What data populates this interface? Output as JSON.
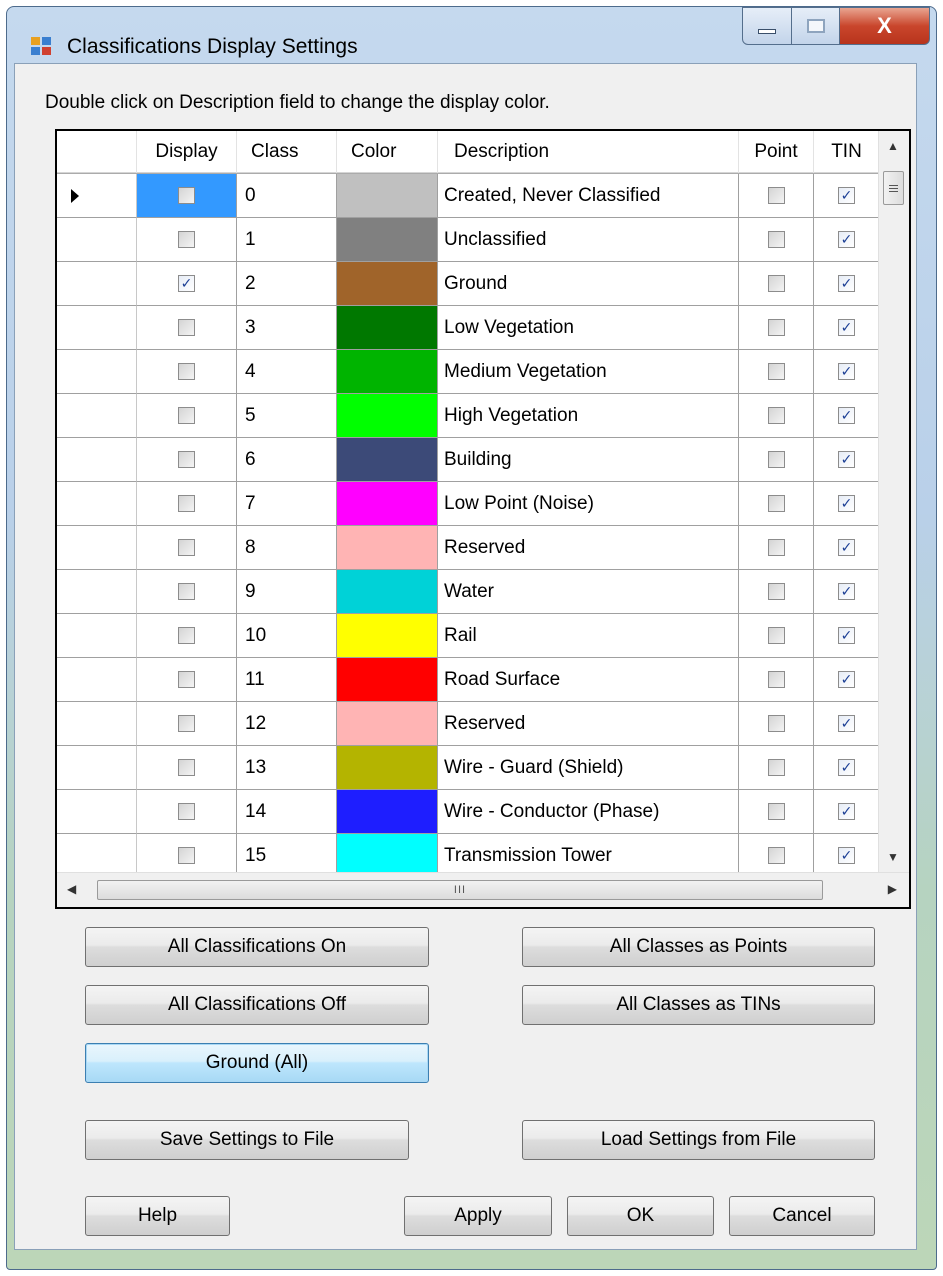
{
  "window": {
    "title": "Classifications Display Settings",
    "close_glyph": "X"
  },
  "instruction": "Double click on Description field to change the display color.",
  "grid": {
    "columns": [
      "Display",
      "Class",
      "Color",
      "Description",
      "Point",
      "TIN"
    ],
    "rows": [
      {
        "display": false,
        "class": "0",
        "color": "#c0c0c0",
        "description": "Created, Never Classified",
        "point": false,
        "tin": true
      },
      {
        "display": false,
        "class": "1",
        "color": "#808080",
        "description": "Unclassified",
        "point": false,
        "tin": true
      },
      {
        "display": true,
        "class": "2",
        "color": "#a0642a",
        "description": "Ground",
        "point": false,
        "tin": true
      },
      {
        "display": false,
        "class": "3",
        "color": "#007800",
        "description": "Low Vegetation",
        "point": false,
        "tin": true
      },
      {
        "display": false,
        "class": "4",
        "color": "#00b400",
        "description": "Medium Vegetation",
        "point": false,
        "tin": true
      },
      {
        "display": false,
        "class": "5",
        "color": "#00ff00",
        "description": "High Vegetation",
        "point": false,
        "tin": true
      },
      {
        "display": false,
        "class": "6",
        "color": "#3c4a78",
        "description": "Building",
        "point": false,
        "tin": true
      },
      {
        "display": false,
        "class": "7",
        "color": "#ff00ff",
        "description": "Low Point (Noise)",
        "point": false,
        "tin": true
      },
      {
        "display": false,
        "class": "8",
        "color": "#ffb4b4",
        "description": "Reserved",
        "point": false,
        "tin": true
      },
      {
        "display": false,
        "class": "9",
        "color": "#00d2d7",
        "description": "Water",
        "point": false,
        "tin": true
      },
      {
        "display": false,
        "class": "10",
        "color": "#ffff00",
        "description": "Rail",
        "point": false,
        "tin": true
      },
      {
        "display": false,
        "class": "11",
        "color": "#ff0000",
        "description": "Road Surface",
        "point": false,
        "tin": true
      },
      {
        "display": false,
        "class": "12",
        "color": "#ffb4b4",
        "description": "Reserved",
        "point": false,
        "tin": true
      },
      {
        "display": false,
        "class": "13",
        "color": "#b4b400",
        "description": "Wire - Guard (Shield)",
        "point": false,
        "tin": true
      },
      {
        "display": false,
        "class": "14",
        "color": "#1e1eff",
        "description": "Wire - Conductor (Phase)",
        "point": false,
        "tin": true
      },
      {
        "display": false,
        "class": "15",
        "color": "#00ffff",
        "description": "Transmission Tower",
        "point": false,
        "tin": true
      }
    ],
    "hscroll_grip": "III"
  },
  "buttons": {
    "all_on": "All Classifications On",
    "all_off": "All Classifications Off",
    "ground_all": "Ground (All)",
    "all_points": "All Classes as Points",
    "all_tins": "All Classes as TINs",
    "save": "Save Settings to File",
    "load": "Load Settings from File",
    "help": "Help",
    "apply": "Apply",
    "ok": "OK",
    "cancel": "Cancel"
  },
  "icons": {
    "app": "app-icon",
    "checkmark": "✓"
  }
}
